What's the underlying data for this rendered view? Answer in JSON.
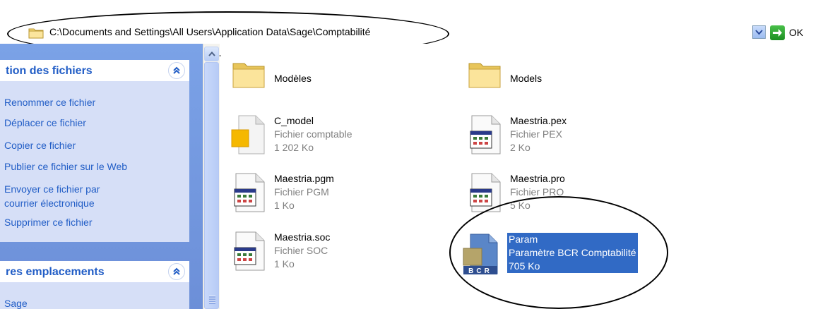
{
  "address_bar": {
    "path": "C:\\Documents and Settings\\All Users\\Application Data\\Sage\\Comptabilité",
    "go_label": "OK"
  },
  "task_pane": {
    "file_tasks": {
      "title": "tion des fichiers",
      "items": [
        "Renommer ce fichier",
        "Déplacer ce fichier",
        "Copier ce fichier",
        "Publier ce fichier sur le Web",
        "Envoyer ce fichier par",
        "courrier électronique",
        "Supprimer ce fichier"
      ]
    },
    "other_places": {
      "title": "res emplacements",
      "items": [
        "Sage"
      ]
    }
  },
  "files": [
    {
      "name": "Modèles",
      "kind": "folder"
    },
    {
      "name": "Models",
      "kind": "folder"
    },
    {
      "name": "C_model",
      "type": "Fichier comptable",
      "size": "1 202 Ko",
      "kind": "comptable"
    },
    {
      "name": "Maestria.pex",
      "type": "Fichier PEX",
      "size": "2 Ko",
      "kind": "app"
    },
    {
      "name": "Maestria.pgm",
      "type": "Fichier PGM",
      "size": "1 Ko",
      "kind": "app"
    },
    {
      "name": "Maestria.pro",
      "type": "Fichier PRO",
      "size": "5 Ko",
      "kind": "app"
    },
    {
      "name": "Maestria.soc",
      "type": "Fichier SOC",
      "size": "1 Ko",
      "kind": "app"
    },
    {
      "name": "Param",
      "type": "Paramètre BCR Comptabilité",
      "size": "705 Ko",
      "kind": "bcr",
      "selected": true
    }
  ],
  "colors": {
    "task_pane_bg": "#7ba2e7",
    "link": "#215dc6",
    "selection": "#316ac5",
    "secondary_text": "#808080"
  },
  "icons": {
    "bcr_label": "BCR"
  }
}
